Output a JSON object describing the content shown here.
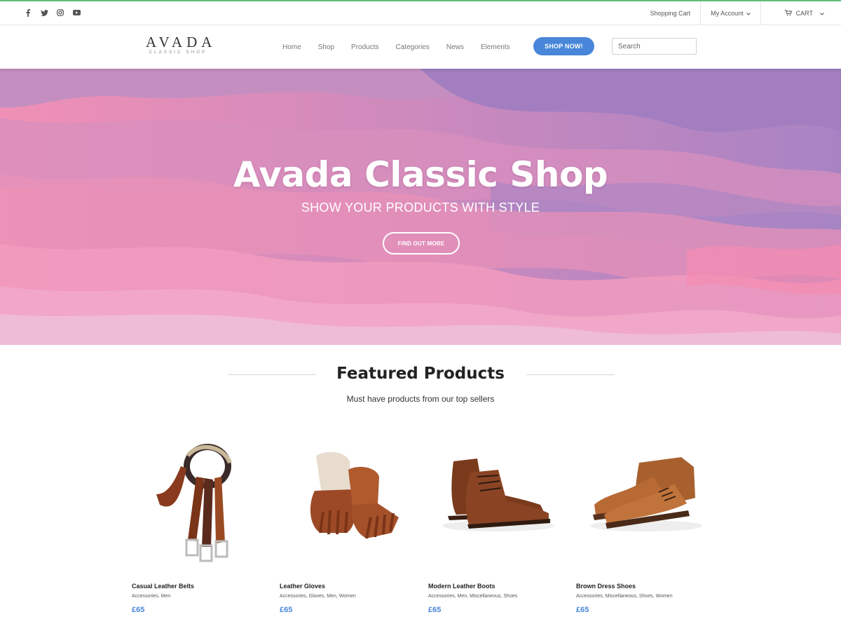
{
  "colors": {
    "accent": "#4886d9",
    "top_line": "#65bc7b"
  },
  "social_icons": [
    "facebook-icon",
    "twitter-icon",
    "instagram-icon",
    "youtube-icon"
  ],
  "top_links": {
    "shopping_cart": "Shopping Cart",
    "my_account": "My Account",
    "cart": "CART"
  },
  "logo": {
    "main": "AVADA",
    "sub": "CLASSIC SHOP"
  },
  "nav": {
    "items": [
      "Home",
      "Shop",
      "Products",
      "Categories",
      "News",
      "Elements"
    ],
    "cta": "SHOP NOW!",
    "search_placeholder": "Search"
  },
  "hero": {
    "title": "Avada Classic Shop",
    "subtitle": "SHOW YOUR PRODUCTS WITH STYLE",
    "button": "FIND OUT MORE"
  },
  "featured": {
    "title": "Featured Products",
    "subtitle": "Must have products from our top sellers"
  },
  "products": [
    {
      "name": "Casual Leather Belts",
      "categories": "Accessories, Men",
      "price": "£65"
    },
    {
      "name": "Leather Gloves",
      "categories": "Accessories, Gloves, Men, Women",
      "price": "£65"
    },
    {
      "name": "Modern Leather Boots",
      "categories": "Accessories, Men, Miscellaneous, Shoes",
      "price": "£65"
    },
    {
      "name": "Brown Dress Shoes",
      "categories": "Accessories, Miscellaneous, Shoes, Women",
      "price": "£65"
    }
  ]
}
